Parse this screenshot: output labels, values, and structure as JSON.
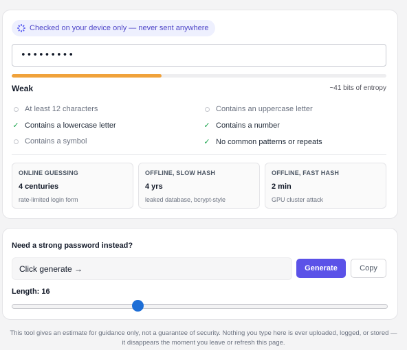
{
  "privacy_notice": "Checked on your device only — never sent anywhere",
  "password_input": {
    "masked_value": "•••••••••"
  },
  "meter": {
    "fill_fraction": 0.4,
    "color": "#f0a23b"
  },
  "strength": {
    "label": "Weak",
    "entropy": "~41 bits of entropy"
  },
  "requirements": [
    {
      "label": "At least 12 characters",
      "met": false
    },
    {
      "label": "Contains an uppercase letter",
      "met": false
    },
    {
      "label": "Contains a lowercase letter",
      "met": true
    },
    {
      "label": "Contains a number",
      "met": true
    },
    {
      "label": "Contains a symbol",
      "met": false
    },
    {
      "label": "No common patterns or repeats",
      "met": true
    }
  ],
  "crack_times": [
    {
      "title": "ONLINE GUESSING",
      "time": "4 centuries",
      "desc": "rate-limited login form"
    },
    {
      "title": "OFFLINE, SLOW HASH",
      "time": "4 yrs",
      "desc": "leaked database, bcrypt-style"
    },
    {
      "title": "OFFLINE, FAST HASH",
      "time": "2 min",
      "desc": "GPU cluster attack"
    }
  ],
  "generator": {
    "title": "Need a strong password instead?",
    "output": "Click generate →",
    "generate_label": "Generate",
    "copy_label": "Copy",
    "length_label": "Length: 16",
    "length_value": 16,
    "accent_color": "#5b52e8"
  },
  "footer": "This tool gives an estimate for guidance only, not a guarantee of security. Nothing you type here is ever uploaded, logged, or stored — it disappears the moment you leave or refresh this page."
}
